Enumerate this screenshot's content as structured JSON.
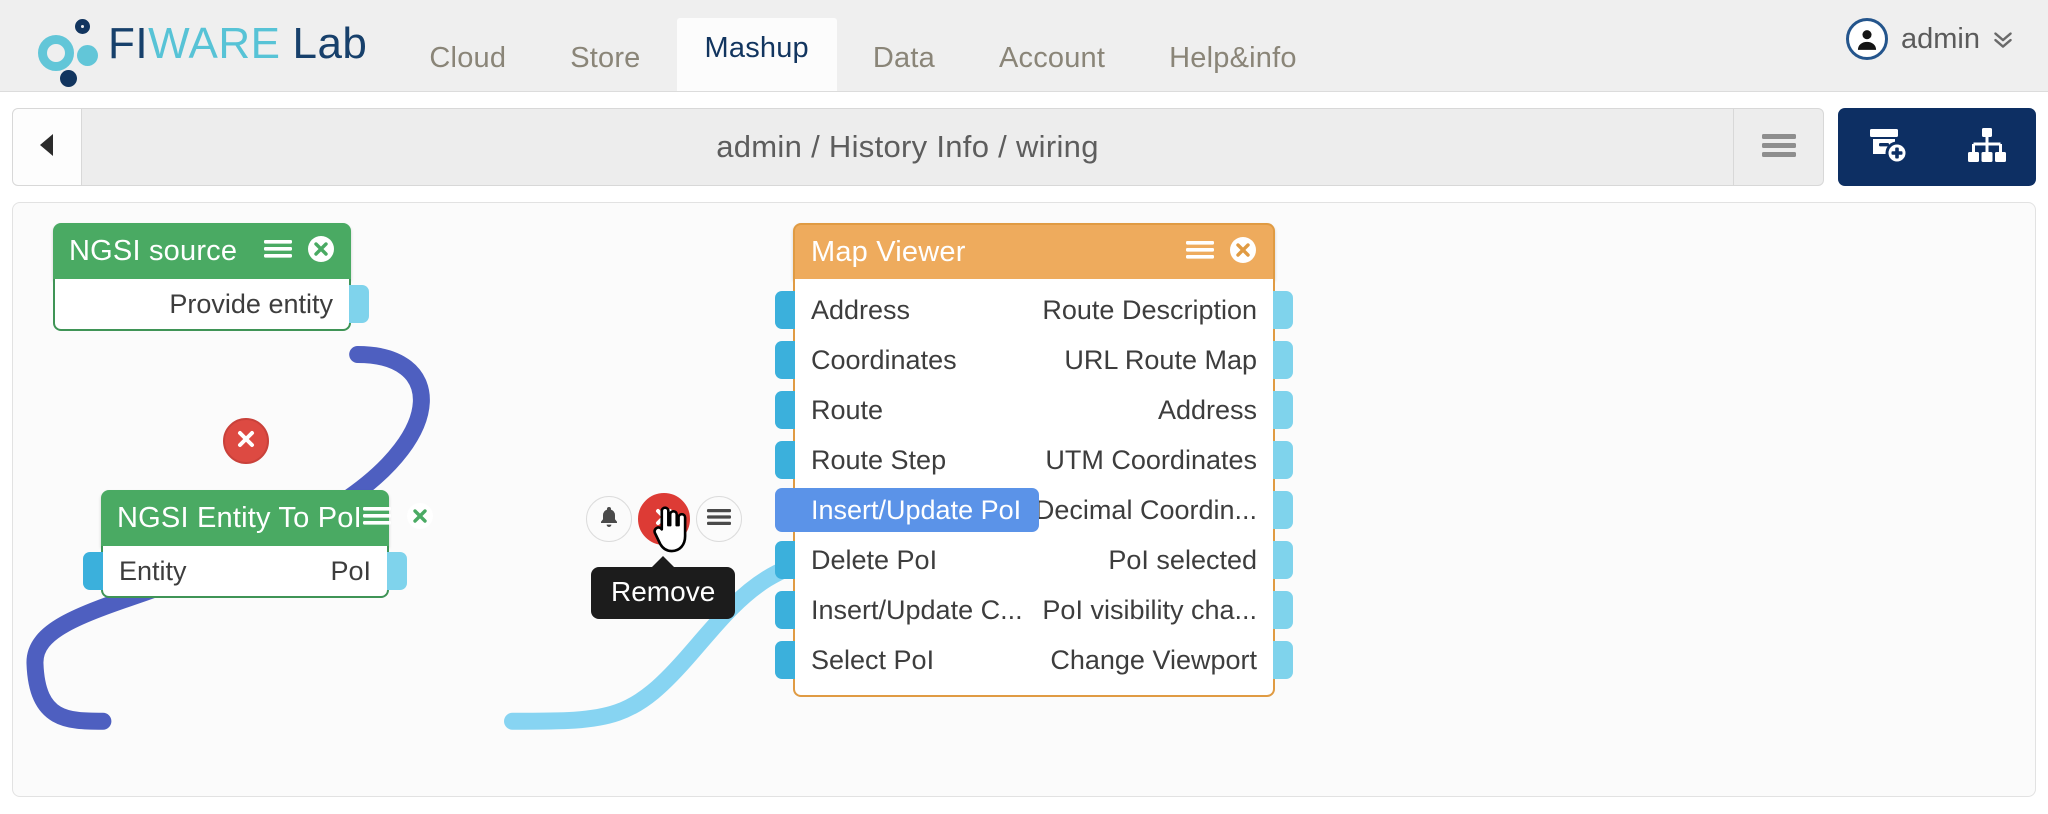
{
  "header": {
    "brand": {
      "part1": "FI",
      "part2": "WARE",
      "part3": "Lab",
      "logo_icon": "fiware-dots-logo"
    },
    "tabs": [
      {
        "label": "Cloud",
        "active": false
      },
      {
        "label": "Store",
        "active": false
      },
      {
        "label": "Mashup",
        "active": true
      },
      {
        "label": "Data",
        "active": false
      },
      {
        "label": "Account",
        "active": false
      },
      {
        "label": "Help&info",
        "active": false
      }
    ],
    "user": {
      "name": "admin",
      "avatar_icon": "user-avatar-icon",
      "chevron_icon": "double-chevron-down-icon"
    }
  },
  "toolbar": {
    "back_icon": "triangle-left-icon",
    "breadcrumb": "admin / History Info / wiring",
    "menu_icon": "hamburger-icon",
    "actions": [
      {
        "name": "add-component",
        "icon": "box-plus-icon"
      },
      {
        "name": "show-hierarchy",
        "icon": "sitemap-icon"
      }
    ]
  },
  "canvas": {
    "widgets": [
      {
        "title": "NGSI source",
        "color": "#4aaa63",
        "menu_icon": "hamburger-icon",
        "close_icon": "close-circle-icon",
        "rows": [
          {
            "in": "",
            "out": "Provide entity"
          }
        ]
      },
      {
        "title": "NGSI Entity To PoI",
        "color": "#4aaa63",
        "menu_icon": "hamburger-icon",
        "close_icon": "close-circle-icon",
        "rows": [
          {
            "in": "Entity",
            "out": "PoI"
          }
        ]
      },
      {
        "title": "Map Viewer",
        "color": "#eeab5d",
        "menu_icon": "hamburger-icon",
        "close_icon": "close-circle-icon",
        "rows": [
          {
            "in": "Address",
            "out": "Route Description",
            "highlight": false
          },
          {
            "in": "Coordinates",
            "out": "URL Route Map",
            "highlight": false
          },
          {
            "in": "Route",
            "out": "Address",
            "highlight": false
          },
          {
            "in": "Route Step",
            "out": "UTM Coordinates",
            "highlight": false
          },
          {
            "in": "Insert/Update PoI",
            "out": "Decimal Coordin...",
            "highlight": true
          },
          {
            "in": "Delete PoI",
            "out": "PoI selected",
            "highlight": false
          },
          {
            "in": "Insert/Update C...",
            "out": "PoI visibility cha...",
            "highlight": false
          },
          {
            "in": "Select PoI",
            "out": "Change Viewport",
            "highlight": false
          }
        ]
      }
    ],
    "connections": [
      {
        "name": "ngsi-source-to-entity-to-poi",
        "color": "#4e5fc0",
        "badge_icon": "close-circle-icon"
      },
      {
        "name": "entity-to-poi-to-map-viewer",
        "color": "#87d4f2"
      }
    ],
    "connection_handles": {
      "bell_icon": "bell-icon",
      "remove_icon": "close-icon",
      "menu_icon": "hamburger-icon",
      "tooltip": "Remove",
      "cursor_icon": "pointing-hand-cursor"
    }
  },
  "colors": {
    "brand_dark": "#12355f",
    "brand_light": "#57c3d6",
    "accent_navy": "#0d2f63",
    "widget_green": "#4aaa63",
    "widget_orange": "#eeab5d",
    "port_in": "#3bb0dc",
    "port_out": "#7fd3ec",
    "highlight_blue": "#5b93e8",
    "danger_red": "#dd3b35",
    "wire_blue_dark": "#4e5fc0",
    "wire_blue_light": "#87d4f2"
  }
}
